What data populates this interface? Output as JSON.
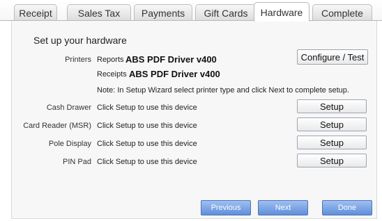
{
  "tabs": [
    "Receipt",
    "Sales Tax",
    "Payments",
    "Gift Cards",
    "Hardware",
    "Complete"
  ],
  "active_tab": "Hardware",
  "section_title": "Set up your hardware",
  "printers": {
    "label": "Printers",
    "reports_label": "Reports",
    "reports_value": "ABS PDF Driver v400",
    "receipts_label": "Receipts",
    "receipts_value": "ABS PDF Driver v400",
    "configure_label": "Configure / Test",
    "note": "Note: In Setup Wizard select printer type and click Next to complete setup."
  },
  "devices": [
    {
      "label": "Cash Drawer",
      "status": "Click Setup to use this device",
      "button": "Setup"
    },
    {
      "label": "Card Reader (MSR)",
      "status": "Click Setup to use this device",
      "button": "Setup"
    },
    {
      "label": "Pole Display",
      "status": "Click Setup to use this device",
      "button": "Setup"
    },
    {
      "label": "PIN Pad",
      "status": "Click Setup to use this device",
      "button": "Setup"
    }
  ],
  "footer": {
    "previous_label": "Previous",
    "next_label": "Next",
    "done_label": "Done"
  }
}
